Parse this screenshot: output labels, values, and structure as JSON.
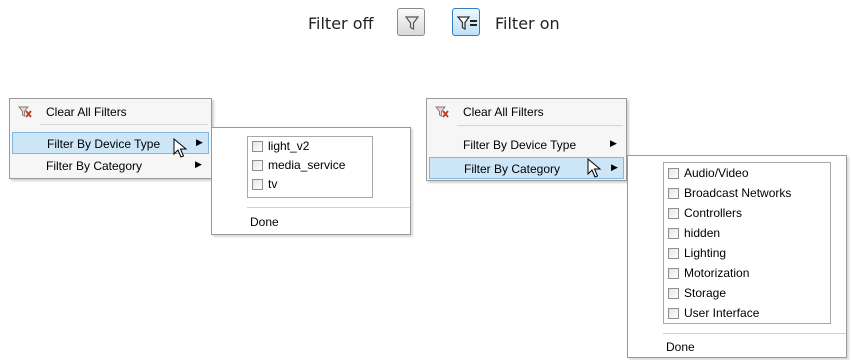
{
  "legend": {
    "filter_off_label": "Filter off",
    "filter_on_label": "Filter on",
    "filter_off_icon": "filter-icon",
    "filter_on_icon": "filter-active-icon",
    "accent": "#2f7fc2"
  },
  "menu_left": {
    "clear_all": "Clear All Filters",
    "by_device_type": "Filter By Device Type",
    "by_category": "Filter By Category",
    "highlighted": "Filter By Device Type"
  },
  "device_type_submenu": {
    "options": [
      "light_v2",
      "media_service",
      "tv"
    ],
    "done": "Done"
  },
  "menu_right": {
    "clear_all": "Clear All Filters",
    "by_device_type": "Filter By Device Type",
    "by_category": "Filter By Category",
    "highlighted": "Filter By Category"
  },
  "category_submenu": {
    "options": [
      "Audio/Video",
      "Broadcast Networks",
      "Controllers",
      "hidden",
      "Lighting",
      "Motorization",
      "Storage",
      "User Interface"
    ],
    "done": "Done"
  },
  "colors": {
    "highlight_bg": "#cde6f7",
    "highlight_border": "#7fb7e2",
    "clear_icon_red": "#c0392b"
  }
}
